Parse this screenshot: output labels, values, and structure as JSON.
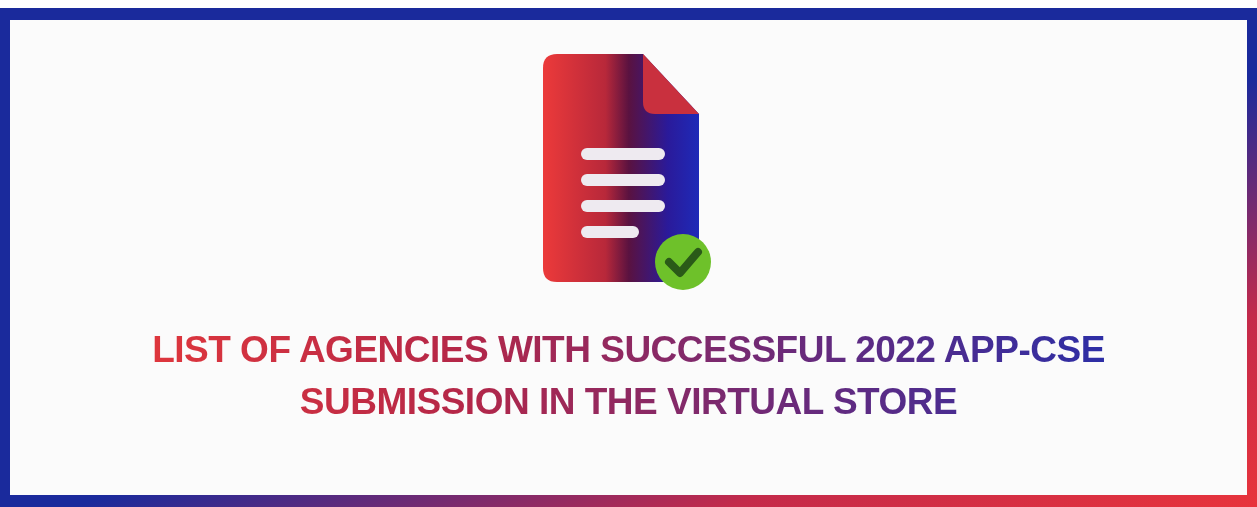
{
  "banner": {
    "title": "LIST OF AGENCIES WITH SUCCESSFUL 2022 APP-CSE SUBMISSION IN THE VIRTUAL STORE"
  }
}
